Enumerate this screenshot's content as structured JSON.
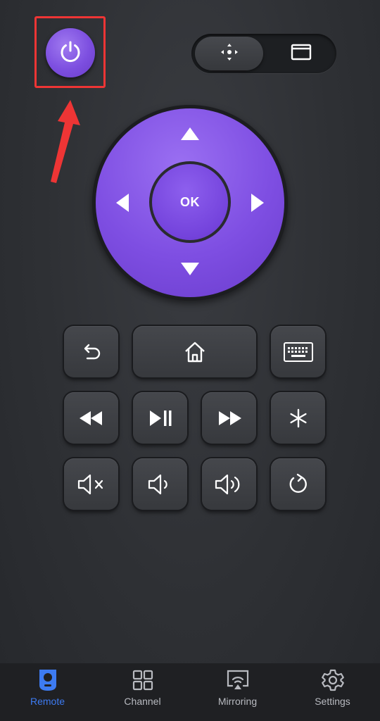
{
  "power": {
    "icon": "power-icon",
    "color": "#7d4fe0"
  },
  "annotation": {
    "box_color": "#ee3535",
    "arrow_color": "#ee3535"
  },
  "mode_toggle": {
    "dpad_icon": "dpad-move-icon",
    "touchpad_icon": "touchpad-icon",
    "selected": "dpad"
  },
  "dpad": {
    "ok_label": "OK",
    "color": "#7e4ee2"
  },
  "keys": [
    {
      "row": 1,
      "icon": "back-icon"
    },
    {
      "row": 1,
      "icon": "home-icon"
    },
    {
      "row": 1,
      "icon": "keyboard-icon"
    },
    {
      "row": 2,
      "icon": "rewind-icon"
    },
    {
      "row": 2,
      "icon": "play-pause-icon"
    },
    {
      "row": 2,
      "icon": "fast-forward-icon"
    },
    {
      "row": 2,
      "icon": "asterisk-icon"
    },
    {
      "row": 3,
      "icon": "mute-icon"
    },
    {
      "row": 3,
      "icon": "volume-down-icon"
    },
    {
      "row": 3,
      "icon": "volume-up-icon"
    },
    {
      "row": 3,
      "icon": "replay-icon"
    }
  ],
  "bottom_nav": {
    "active_color": "#3d7bf2",
    "items": [
      {
        "label": "Remote",
        "icon": "remote-icon",
        "active": true
      },
      {
        "label": "Channel",
        "icon": "grid-icon",
        "active": false
      },
      {
        "label": "Mirroring",
        "icon": "mirroring-icon",
        "active": false
      },
      {
        "label": "Settings",
        "icon": "gear-icon",
        "active": false
      }
    ]
  }
}
